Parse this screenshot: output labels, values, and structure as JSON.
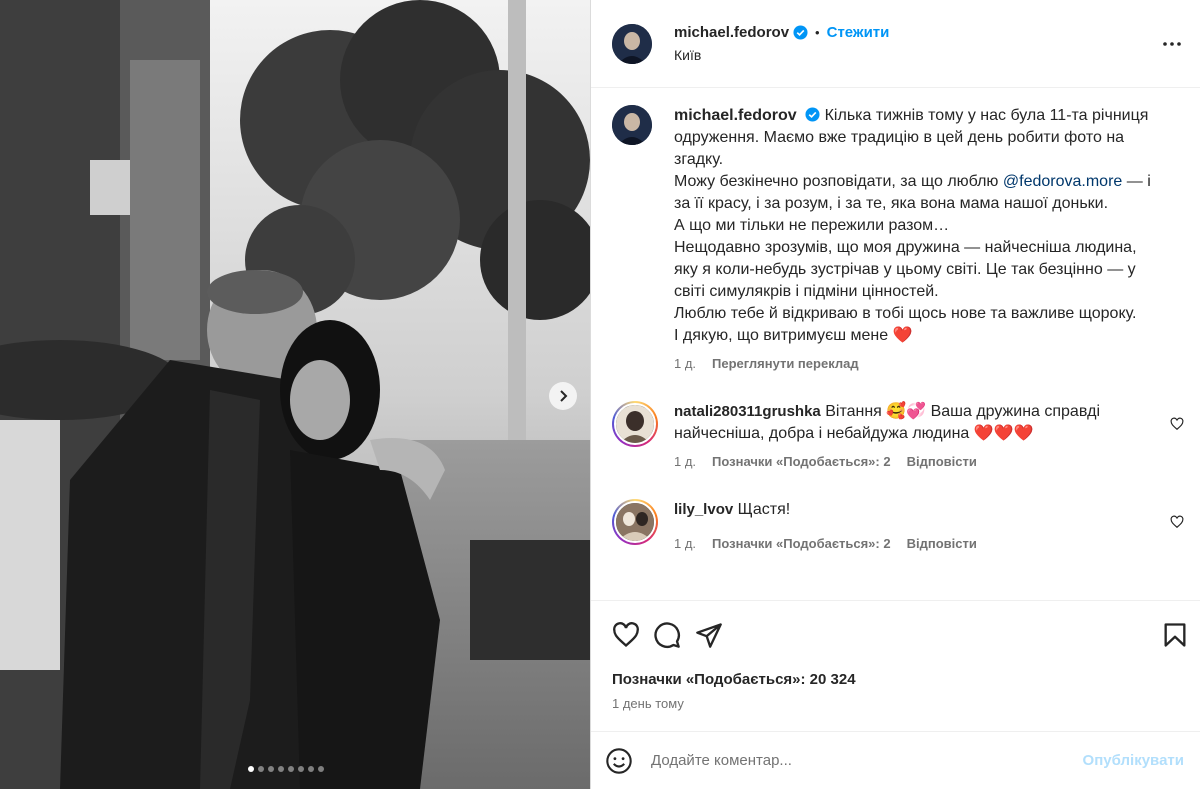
{
  "header": {
    "username": "michael.fedorov",
    "separator": "•",
    "follow_label": "Стежити",
    "location": "Київ"
  },
  "caption": {
    "username": "michael.fedorov",
    "text_1": "Кілька тижнів тому у нас була 11-та річниця одруження. Маємо вже традицію в цей день робити фото на згадку.",
    "text_2": "Можу безкінечно розповідати, за що люблю",
    "mention": "@fedorova.more",
    "text_3": "— і за її красу, і за розум, і за те, яка вона мама нашої доньки.",
    "text_4": "А що ми тільки не пережили разом…",
    "text_5": "Нещодавно зрозумів, що моя дружина — найчесніша людина, яку я коли-небудь зустрічав у цьому світі. Це так безцінно — у світі симулякрів і підміни цінностей.",
    "text_6": "Люблю тебе й відкриваю в тобі щось нове та важливе щороку.",
    "text_7": "І дякую, що витримуєш мене ❤️",
    "time": "1 д.",
    "translate_label": "Переглянути переклад"
  },
  "comments": [
    {
      "username": "natali280311grushka",
      "text": "Вітання 🥰💞 Ваша дружина справді найчесніша, добра і небайдужа людина ❤️❤️❤️",
      "time": "1 д.",
      "likes": "Позначки «Подобається»: 2",
      "reply_label": "Відповісти"
    },
    {
      "username": "lily_lvov",
      "text": "Щастя!",
      "time": "1 д.",
      "likes": "Позначки «Подобається»: 2",
      "reply_label": "Відповісти"
    }
  ],
  "actions": {
    "icons": [
      "heart-icon",
      "comment-icon",
      "share-icon",
      "bookmark-icon"
    ],
    "likes_label": "Позначки «Подобається»: 20 324",
    "time_ago": "1 день тому"
  },
  "comment_box": {
    "placeholder": "Додайте коментар...",
    "post_label": "Опублікувати"
  },
  "carousel": {
    "slides": 8,
    "active_index": 0
  },
  "colors": {
    "accent": "#0095f6",
    "post_disabled": "#b2dffc",
    "secondary_text": "#737373",
    "heart_red": "#ed4956"
  }
}
